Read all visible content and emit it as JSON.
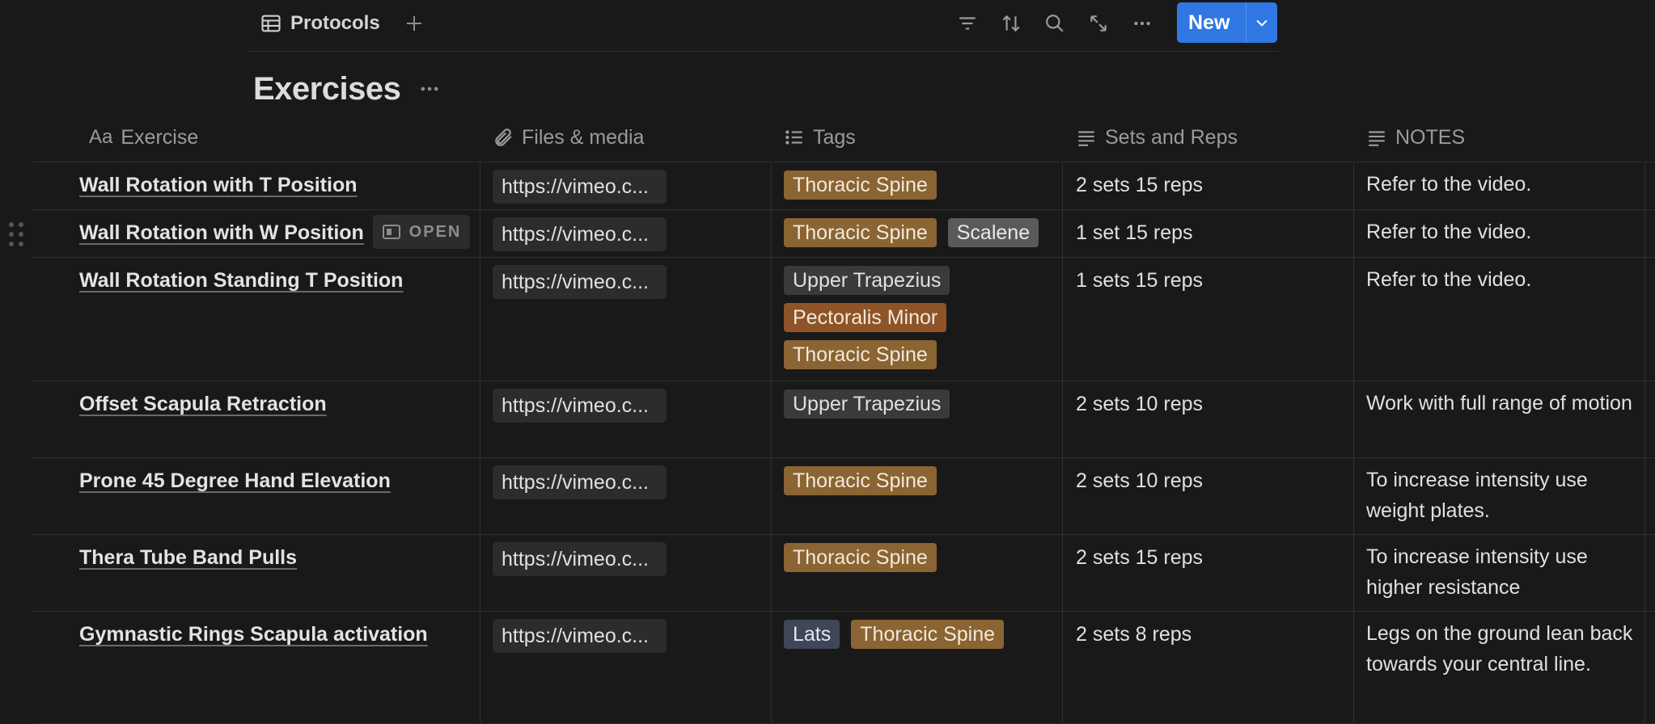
{
  "toolbar": {
    "view_name": "Protocols",
    "new_label": "New",
    "icons": [
      "table-icon",
      "plus-icon",
      "filter-icon",
      "sort-icon",
      "search-icon",
      "expand-icon",
      "more-icon",
      "chevron-down-icon"
    ]
  },
  "page": {
    "title": "Exercises"
  },
  "columns": [
    {
      "label": "Exercise",
      "icon": "Aa"
    },
    {
      "label": "Files & media",
      "icon": "paperclip-icon"
    },
    {
      "label": "Tags",
      "icon": "list-icon"
    },
    {
      "label": "Sets and Reps",
      "icon": "text-icon"
    },
    {
      "label": "NOTES",
      "icon": "text-icon"
    }
  ],
  "rows": [
    {
      "name": "Wall Rotation with T Position",
      "file": "https://vimeo.c...",
      "tags": [
        {
          "label": "Thoracic Spine",
          "color": "#8a6432"
        }
      ],
      "sets": "2 sets 15 reps",
      "notes": "Refer to the video."
    },
    {
      "name": "Wall Rotation with W Position",
      "file": "https://vimeo.c...",
      "tags": [
        {
          "label": "Thoracic Spine",
          "color": "#8a6432"
        },
        {
          "label": "Scalene",
          "color": "#5a5a5a"
        }
      ],
      "sets": "1 set 15 reps",
      "notes": "Refer to the video.",
      "open_label": "OPEN"
    },
    {
      "name": "Wall Rotation Standing T Position",
      "file": "https://vimeo.c...",
      "tags": [
        {
          "label": "Upper Trapezius",
          "color": "#3a3a3a"
        },
        {
          "label": "Pectoralis Minor",
          "color": "#8e5428"
        },
        {
          "label": "Thoracic Spine",
          "color": "#8a6432"
        }
      ],
      "sets": "1 sets 15 reps",
      "notes": "Refer to the video."
    },
    {
      "name": "Offset Scapula Retraction",
      "file": "https://vimeo.c...",
      "tags": [
        {
          "label": "Upper Trapezius",
          "color": "#3a3a3a"
        }
      ],
      "sets": "2 sets 10 reps",
      "notes": "Work with full range of motion"
    },
    {
      "name": "Prone 45 Degree Hand Elevation",
      "file": "https://vimeo.c...",
      "tags": [
        {
          "label": "Thoracic Spine",
          "color": "#8a6432"
        }
      ],
      "sets": "2 sets 10 reps",
      "notes": "To increase intensity use weight plates."
    },
    {
      "name": "Thera Tube Band Pulls",
      "file": "https://vimeo.c...",
      "tags": [
        {
          "label": "Thoracic Spine",
          "color": "#8a6432"
        }
      ],
      "sets": "2 sets 15 reps",
      "notes": "To increase intensity use higher resistance"
    },
    {
      "name": "Gymnastic Rings Scapula activation",
      "file": "https://vimeo.c...",
      "tags": [
        {
          "label": "Lats",
          "color": "#3e4657"
        },
        {
          "label": "Thoracic Spine",
          "color": "#8a6432"
        }
      ],
      "sets": "2 sets 8 reps",
      "notes": "Legs on the ground lean back towards your central line."
    }
  ]
}
